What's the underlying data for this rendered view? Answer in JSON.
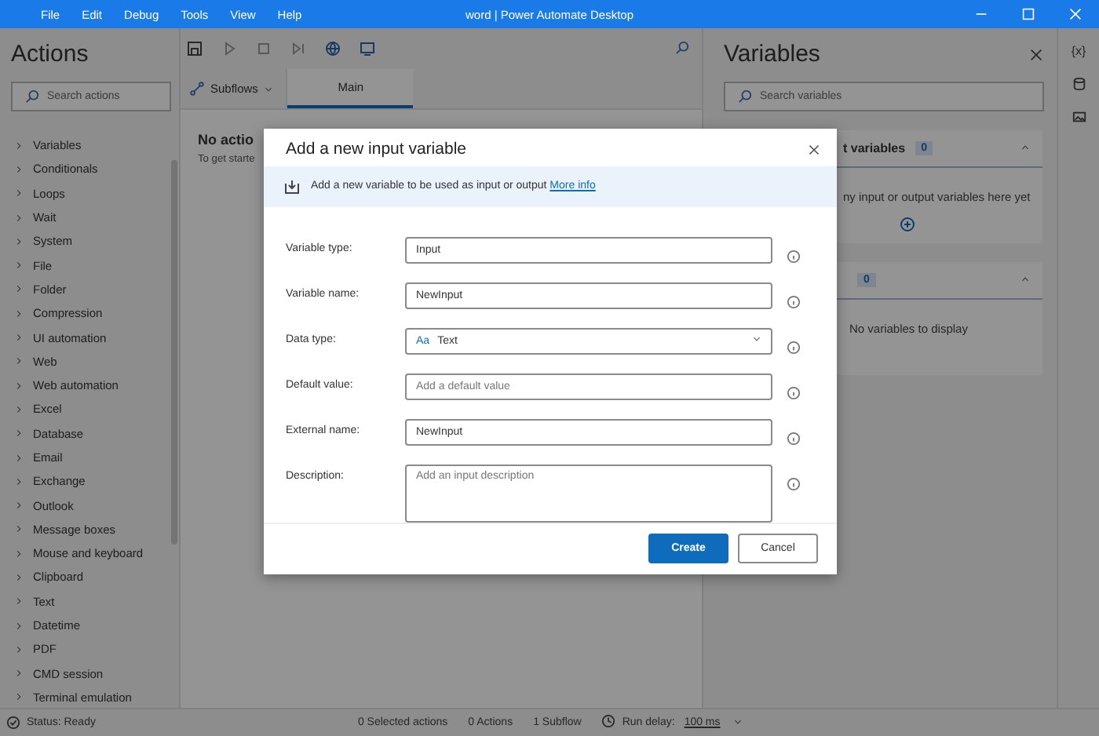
{
  "window": {
    "title": "word | Power Automate Desktop",
    "menu": [
      "File",
      "Edit",
      "Debug",
      "Tools",
      "View",
      "Help"
    ]
  },
  "actions_panel": {
    "title": "Actions",
    "search_placeholder": "Search actions",
    "items": [
      {
        "label": "Variables"
      },
      {
        "label": "Conditionals"
      },
      {
        "label": "Loops"
      },
      {
        "label": "Wait"
      },
      {
        "label": "System"
      },
      {
        "label": "File"
      },
      {
        "label": "Folder"
      },
      {
        "label": "Compression"
      },
      {
        "label": "UI automation"
      },
      {
        "label": "Web"
      },
      {
        "label": "Web automation"
      },
      {
        "label": "Excel"
      },
      {
        "label": "Database"
      },
      {
        "label": "Email"
      },
      {
        "label": "Exchange"
      },
      {
        "label": "Outlook"
      },
      {
        "label": "Message boxes"
      },
      {
        "label": "Mouse and keyboard"
      },
      {
        "label": "Clipboard"
      },
      {
        "label": "Text"
      },
      {
        "label": "Datetime"
      },
      {
        "label": "PDF"
      },
      {
        "label": "CMD session"
      },
      {
        "label": "Terminal emulation"
      }
    ]
  },
  "designer": {
    "subflows_label": "Subflows",
    "tabs": [
      {
        "label": "Main",
        "selected": true
      }
    ],
    "empty_title": "No actio",
    "empty_hint": "To get starte"
  },
  "variables_panel": {
    "title": "Variables",
    "search_placeholder": "Search variables",
    "sections": [
      {
        "kind": "add",
        "title": "t variables",
        "count": "0",
        "expanded": true,
        "message": "ny input or output variables here yet"
      },
      {
        "kind": "plain",
        "count": "0",
        "expanded": true,
        "message": "No variables to display"
      }
    ]
  },
  "side_strip": {
    "variables_label": "{x}"
  },
  "dialog": {
    "title": "Add a new input variable",
    "info": "Add a new variable to be used as input or output",
    "link": "More info",
    "fields": [
      {
        "kind": "text",
        "label": "Variable type:",
        "value": "Input"
      },
      {
        "kind": "text",
        "label": "Variable name:",
        "value": "NewInput"
      },
      {
        "kind": "select",
        "label": "Data type:",
        "prefix": "Aa",
        "value": "Text"
      },
      {
        "kind": "text",
        "label": "Default value:",
        "placeholder": "Add a default value"
      },
      {
        "kind": "text",
        "label": "External name:",
        "value": "NewInput"
      },
      {
        "kind": "textarea",
        "label": "Description:",
        "placeholder": "Add an input description"
      }
    ],
    "buttons": [
      {
        "label": "Create",
        "primary": true
      },
      {
        "label": "Cancel",
        "primary": false
      }
    ]
  },
  "status_bar": {
    "status": "Status: Ready",
    "selected_actions": "0 Selected actions",
    "actions": "0 Actions",
    "subflows": "1 Subflow",
    "run_delay_label": "Run delay:",
    "run_delay": "100 ms"
  }
}
